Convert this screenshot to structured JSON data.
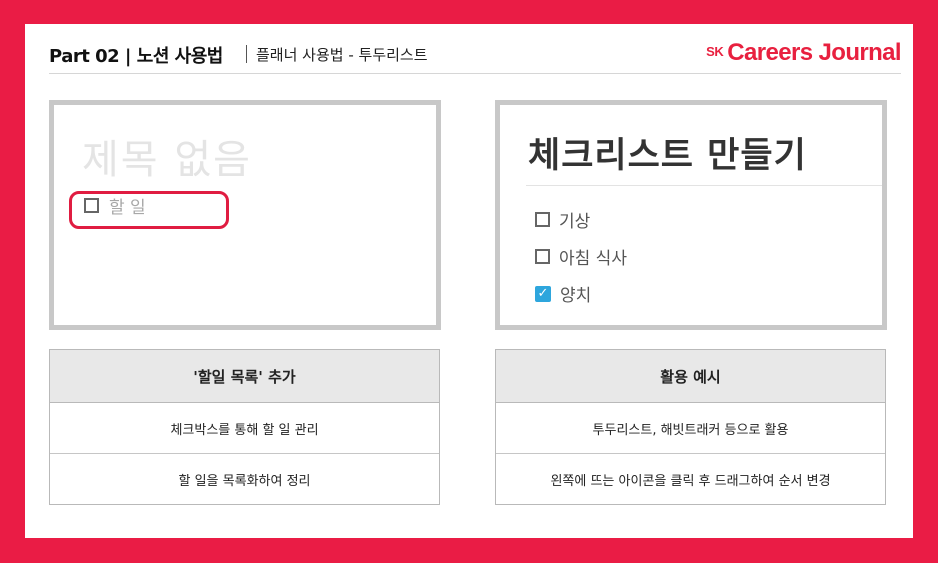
{
  "header": {
    "part_title": "Part 02 | 노션 사용법",
    "sub_title": "플래너 사용법 - 투두리스트",
    "brand_sk": "SK",
    "brand_name": "Careers Journal"
  },
  "left_panel": {
    "untitled_text": "제목 없음",
    "todo_placeholder": "할 일"
  },
  "right_panel": {
    "title": "체크리스트 만들기",
    "items": [
      {
        "label": "기상",
        "checked": false
      },
      {
        "label": "아침 식사",
        "checked": false
      },
      {
        "label": "양치",
        "checked": true
      }
    ],
    "check_color": "#2ea6dd"
  },
  "left_table": {
    "header": "'할일 목록' 추가",
    "rows": [
      "체크박스를 통해 할 일 관리",
      "할 일을 목록화하여 정리"
    ]
  },
  "right_table": {
    "header": "활용 예시",
    "rows": [
      "투두리스트, 해빗트래커 등으로 활용",
      "왼쪽에 뜨는 아이콘을 클릭 후 드래그하여 순서 변경"
    ]
  },
  "colors": {
    "frame": "#ea1c45",
    "brand": "#e8203f",
    "highlight": "#e01c41"
  }
}
